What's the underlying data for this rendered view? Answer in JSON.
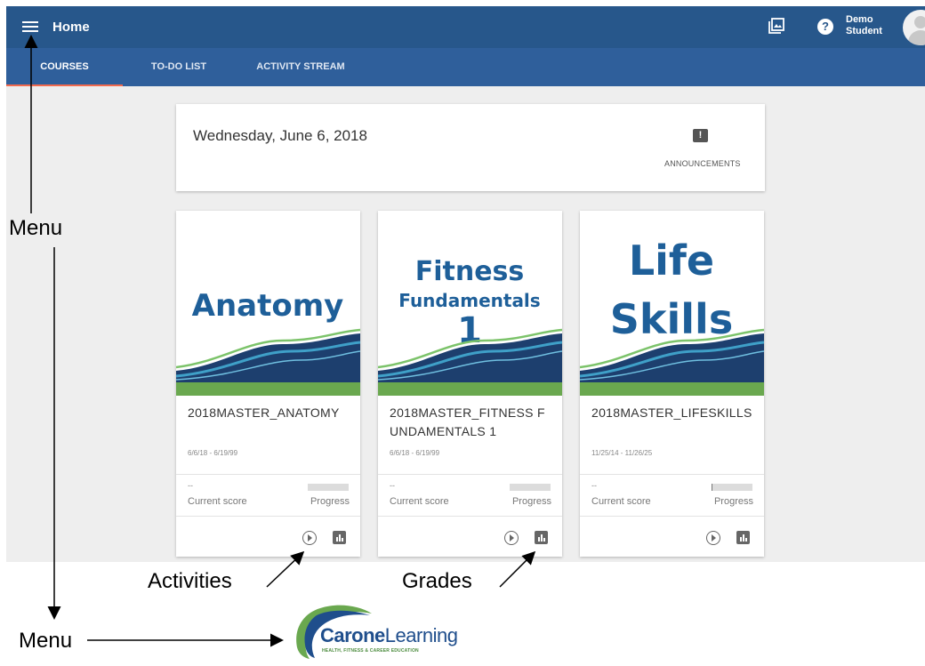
{
  "header": {
    "title": "Home",
    "user_first": "Demo",
    "user_last": "Student"
  },
  "tabs": [
    {
      "label": "COURSES",
      "active": true
    },
    {
      "label": "TO-DO LIST",
      "active": false
    },
    {
      "label": "ACTIVITY STREAM",
      "active": false
    }
  ],
  "date_card": {
    "date": "Wednesday, June 6, 2018",
    "announcements_label": "ANNOUNCEMENTS"
  },
  "courses": [
    {
      "cover_title": [
        "Anatomy"
      ],
      "name": "2018MASTER_ANATOMY",
      "dates": "6/6/18 - 6/19/99",
      "score": "--",
      "score_label": "Current score",
      "progress_label": "Progress",
      "progress": 0
    },
    {
      "cover_title": [
        "Fitness",
        "Fundamentals",
        "1"
      ],
      "name": "2018MASTER_FITNESS FUNDAMENTALS 1",
      "dates": "6/6/18 - 6/19/99",
      "score": "--",
      "score_label": "Current score",
      "progress_label": "Progress",
      "progress": 0
    },
    {
      "cover_title": [
        "Life",
        "Skills"
      ],
      "name": "2018MASTER_LIFESKILLS",
      "dates": "11/25/14 - 11/26/25",
      "score": "--",
      "score_label": "Current score",
      "progress_label": "Progress",
      "progress": 0.02
    }
  ],
  "annotations": {
    "menu_top": "Menu",
    "menu_bottom": "Menu",
    "activities": "Activities",
    "grades": "Grades"
  },
  "logo": {
    "brand_bold": "Carone",
    "brand_light": "Learning",
    "tagline": "HEALTH, FITNESS & CAREER EDUCATION"
  },
  "colors": {
    "topbar": "#27578b",
    "tabbar": "#2f5f9b",
    "active_tab_underline": "#f26a4f",
    "cover_title": "#1e5f99",
    "cover_green": "#6aa84f"
  }
}
